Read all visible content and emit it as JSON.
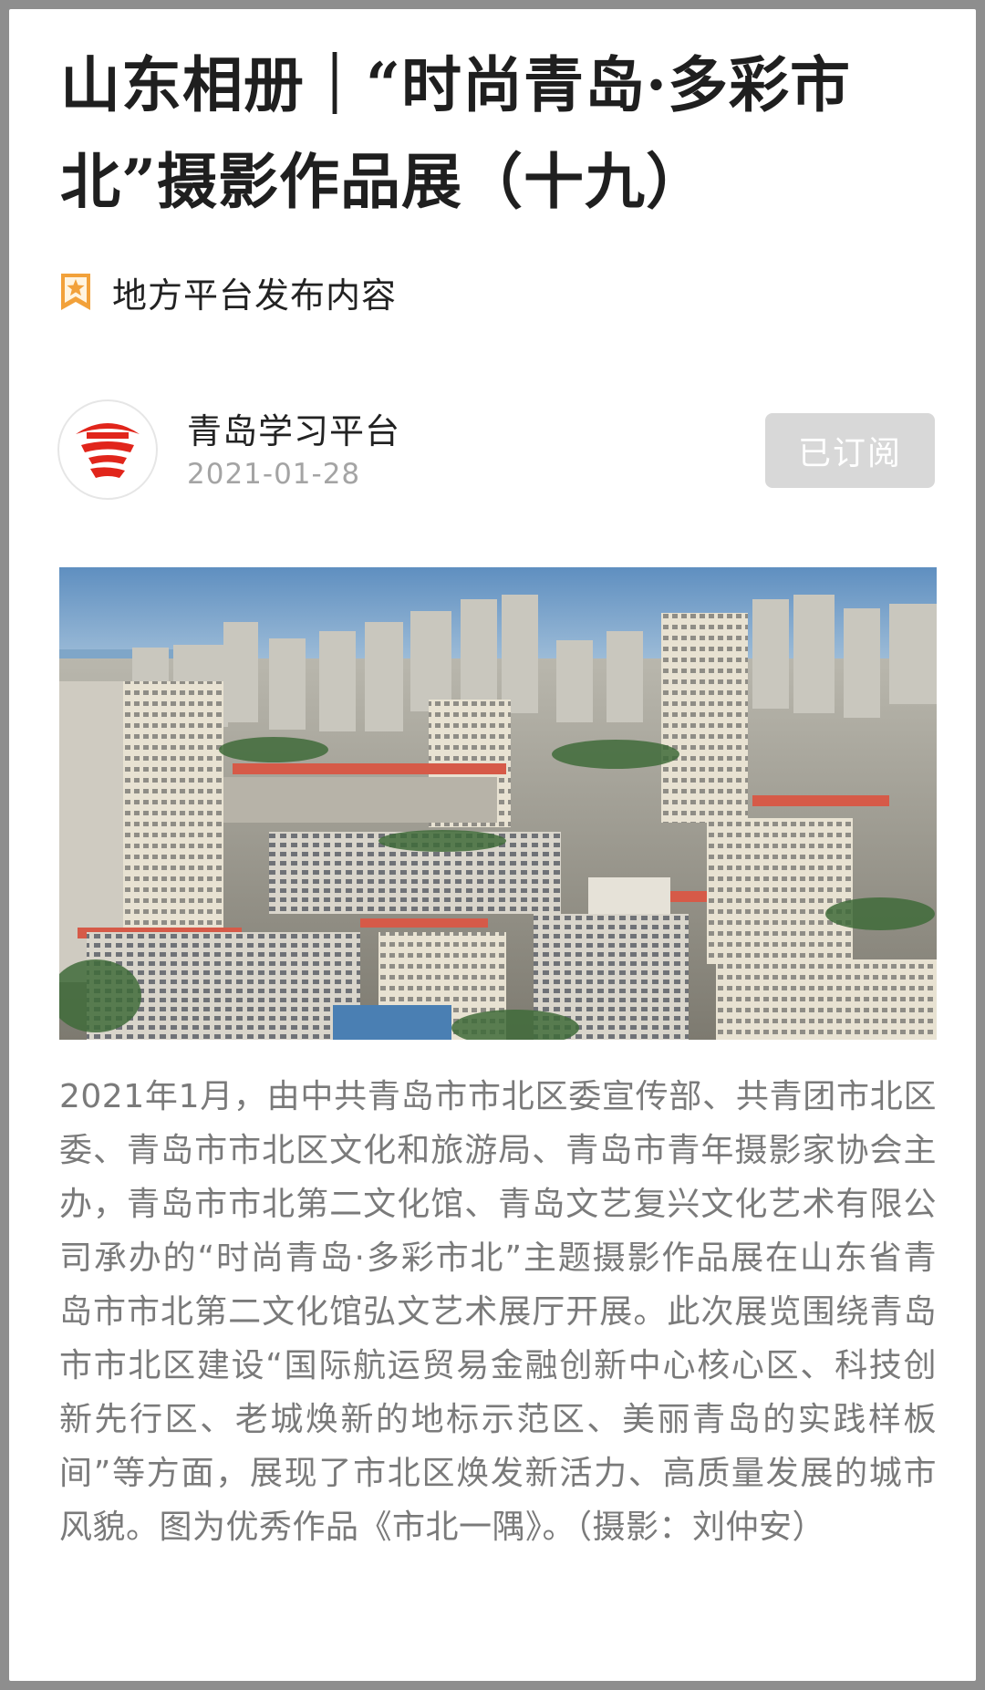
{
  "article": {
    "title": "山东相册｜“时尚青岛·多彩市北”摄影作品展（十九）",
    "tag": {
      "icon": "bookmark-star-icon",
      "label": "地方平台发布内容"
    },
    "author": {
      "avatar_icon": "qingdao-platform-logo-icon",
      "name": "青岛学习平台",
      "date": "2021-01-28",
      "subscribe_label": "已订阅"
    },
    "photo": {
      "subject": "city-skyline-photo"
    },
    "body": "2021年1月，由中共青岛市市北区委宣传部、共青团市北区委、青岛市市北区文化和旅游局、青岛市青年摄影家协会主办，青岛市市北第二文化馆、青岛文艺复兴文化艺术有限公司承办的“时尚青岛·多彩市北”主题摄影作品展在山东省青岛市市北第二文化馆弘文艺术展厅开展。此次展览围绕青岛市市北区建设“国际航运贸易金融创新中心核心区、科技创新先行区、老城焕新的地标示范区、美丽青岛的实践样板间”等方面，展现了市北区焕发新活力、高质量发展的城市风貌。图为优秀作品《市北一隅》。（摄影：刘仲安）"
  },
  "colors": {
    "frame": "#8e8e8e",
    "background": "#ffffff",
    "title": "#1f1f1f",
    "body_text": "#7a7a7a",
    "date_text": "#a4a4a4",
    "subscribe_button": "#d8d8d8",
    "brand_red": "#e1251b",
    "tag_orange": "#f2a13a"
  }
}
